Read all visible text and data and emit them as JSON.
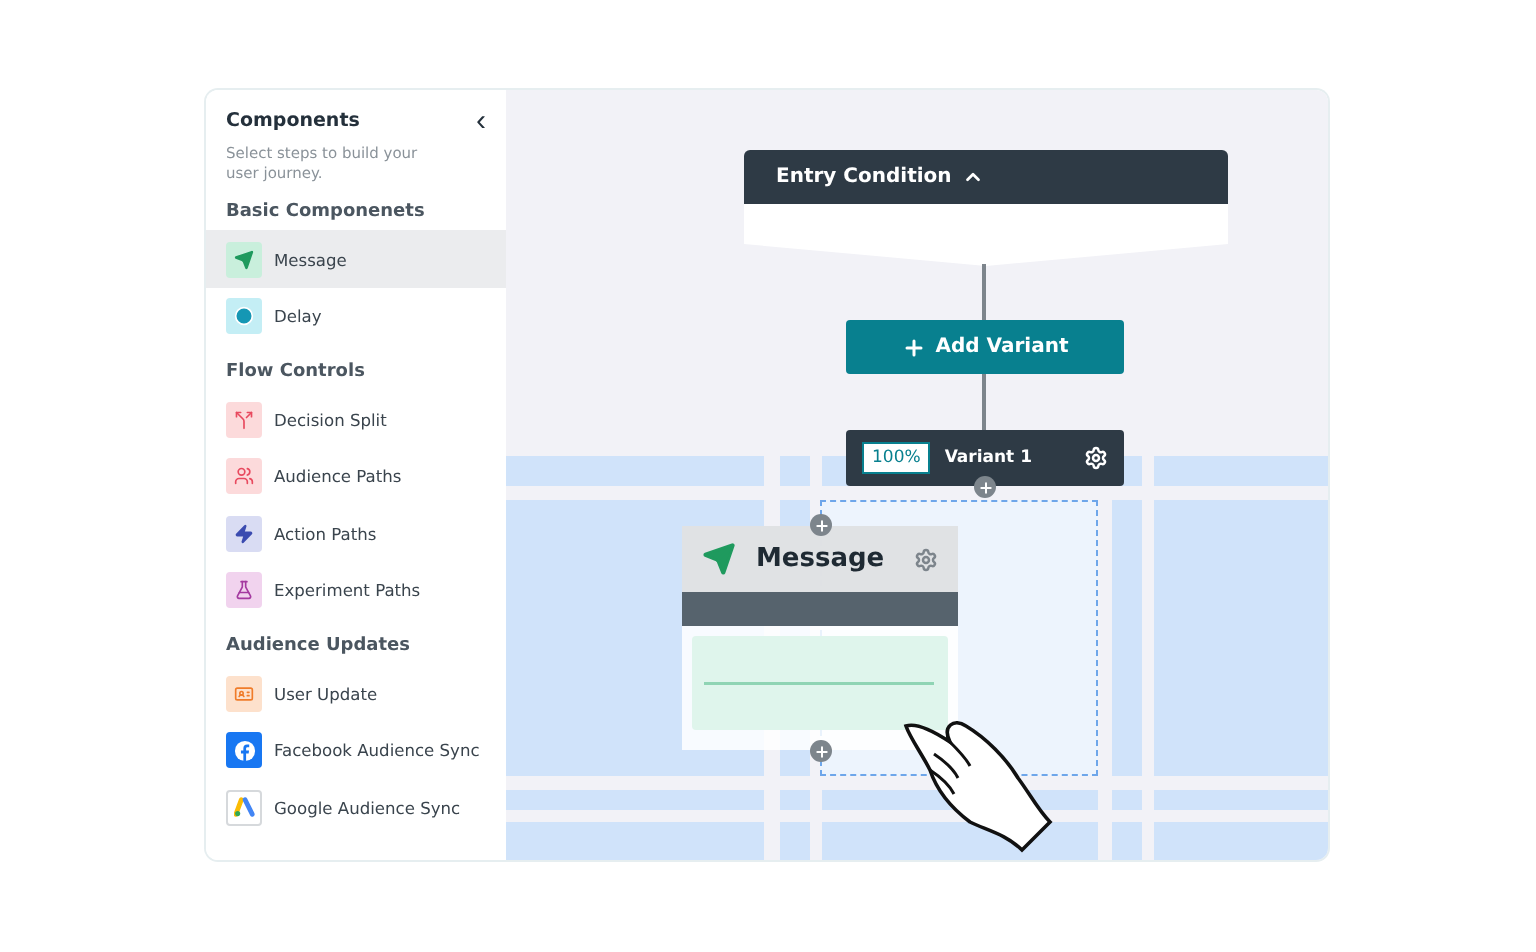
{
  "sidebar": {
    "title": "Components",
    "collapse_icon": "‹",
    "subtitle": "Select steps to build your user journey.",
    "sections": [
      {
        "title": "Basic Componenets",
        "items": [
          {
            "label": "Message",
            "kind": "send",
            "color": "#c9efdc",
            "selected": true
          },
          {
            "label": "Delay",
            "kind": "clock",
            "color": "#c4eef5",
            "selected": false
          }
        ]
      },
      {
        "title": "Flow Controls",
        "items": [
          {
            "label": "Decision Split",
            "kind": "split",
            "color": "#fcdadb",
            "selected": false
          },
          {
            "label": "Audience Paths",
            "kind": "people",
            "color": "#fcdadb",
            "selected": false
          },
          {
            "label": "Action Paths",
            "kind": "bolt",
            "color": "#d9dcf3",
            "selected": false
          },
          {
            "label": "Experiment Paths",
            "kind": "flask",
            "color": "#f1d3ee",
            "selected": false
          }
        ]
      },
      {
        "title": "Audience Updates",
        "items": [
          {
            "label": "User Update",
            "kind": "card",
            "color": "#fde1cc",
            "selected": false
          },
          {
            "label": "Facebook Audience Sync",
            "kind": "facebook",
            "color": "#1877f2",
            "selected": false
          },
          {
            "label": "Google Audience Sync",
            "kind": "ads",
            "color": "#ffffff",
            "selected": false
          }
        ]
      }
    ]
  },
  "canvas": {
    "entry_condition": {
      "title": "Entry Condition",
      "expanded": true
    },
    "add_variant": {
      "label": "Add Variant"
    },
    "variant": {
      "percent": "100%",
      "label": "Variant 1"
    },
    "message_card": {
      "title": "Message"
    }
  }
}
